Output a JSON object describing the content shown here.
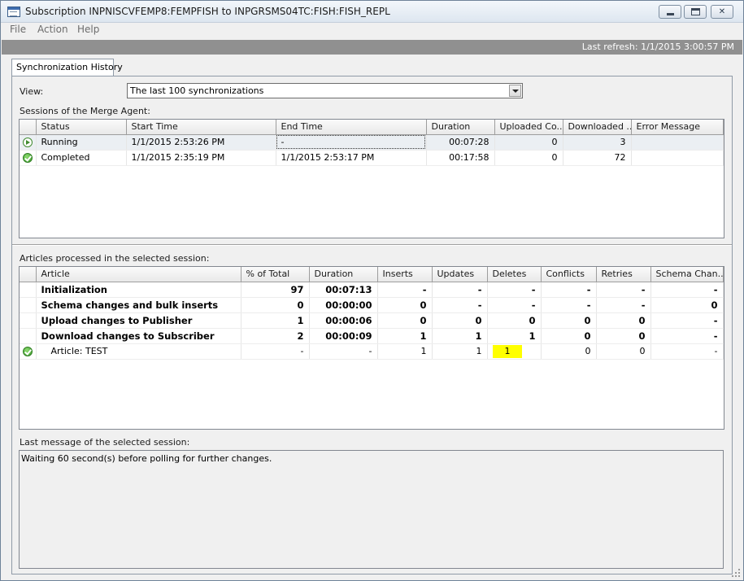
{
  "window": {
    "title": "Subscription INPNISCVFEMP8:FEMPFISH to INPGRSMS04TC:FISH:FISH_REPL",
    "icon": "app-window-icon",
    "controls": {
      "minimize": "minimize",
      "maximize": "maximize",
      "close": "✕"
    }
  },
  "menu": [
    "File",
    "Action",
    "Help"
  ],
  "refresh": {
    "text": "Last refresh: 1/1/2015 3:00:57 PM",
    "bar_color": "#909090"
  },
  "tab": {
    "label": "Synchronization History"
  },
  "view": {
    "label": "View:",
    "selected": "The last 100 synchronizations"
  },
  "sessions": {
    "label": "Sessions of the Merge Agent:",
    "columns": [
      "Status",
      "Start Time",
      "End Time",
      "Duration",
      "Uploaded Co...",
      "Downloaded ...",
      "Error Message"
    ],
    "rows": [
      {
        "icon": "running-icon",
        "status": "Running",
        "start": "1/1/2015 2:53:26 PM",
        "end": "-",
        "duration": "00:07:28",
        "uploaded": "0",
        "downloaded": "3",
        "error": ""
      },
      {
        "icon": "success-check-icon",
        "status": "Completed",
        "start": "1/1/2015 2:35:19 PM",
        "end": "1/1/2015 2:53:17 PM",
        "duration": "00:17:58",
        "uploaded": "0",
        "downloaded": "72",
        "error": ""
      }
    ]
  },
  "articles": {
    "label": "Articles processed in the selected session:",
    "columns": [
      "Article",
      "% of Total",
      "Duration",
      "Inserts",
      "Updates",
      "Deletes",
      "Conflicts",
      "Retries",
      "Schema Chan..."
    ],
    "rows": [
      {
        "icon": "",
        "article": "Initialization",
        "pct": "97",
        "duration": "00:07:13",
        "inserts": "-",
        "updates": "-",
        "deletes": "-",
        "conflicts": "-",
        "retries": "-",
        "schema": "-",
        "bold": true
      },
      {
        "icon": "",
        "article": "Schema changes and bulk inserts",
        "pct": "0",
        "duration": "00:00:00",
        "inserts": "0",
        "updates": "-",
        "deletes": "-",
        "conflicts": "-",
        "retries": "-",
        "schema": "0",
        "bold": true
      },
      {
        "icon": "",
        "article": "Upload changes to Publisher",
        "pct": "1",
        "duration": "00:00:06",
        "inserts": "0",
        "updates": "0",
        "deletes": "0",
        "conflicts": "0",
        "retries": "0",
        "schema": "-",
        "bold": true
      },
      {
        "icon": "",
        "article": "Download changes to Subscriber",
        "pct": "2",
        "duration": "00:00:09",
        "inserts": "1",
        "updates": "1",
        "deletes": "1",
        "conflicts": "0",
        "retries": "0",
        "schema": "-",
        "bold": true
      },
      {
        "icon": "success-check-icon",
        "article": "Article: TEST",
        "pct": "-",
        "duration": "-",
        "inserts": "1",
        "updates": "1",
        "deletes": "1",
        "conflicts": "0",
        "retries": "0",
        "schema": "-",
        "bold": false
      }
    ],
    "highlight_color": "#ffff00"
  },
  "last_message": {
    "label": "Last message of the selected session:",
    "text": "Waiting 60 second(s) before polling for further changes."
  }
}
